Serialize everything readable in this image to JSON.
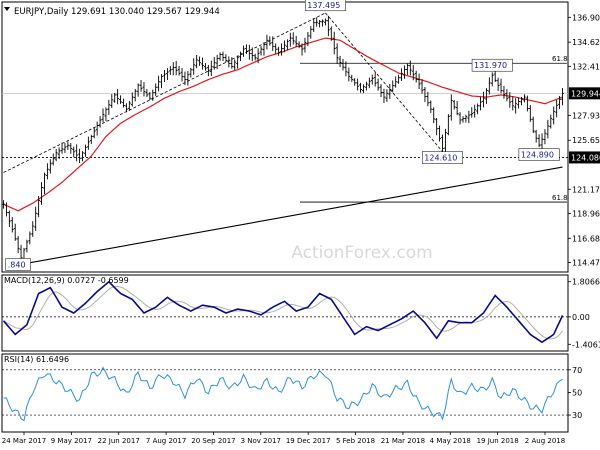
{
  "chart_data": {
    "type": "line",
    "header": {
      "symbol_label": "EURJPY,Daily",
      "ohlc": [
        "129.691",
        "130.040",
        "129.567",
        "129.944"
      ]
    },
    "watermark": "ActionForex.com",
    "x_ticks": [
      "24 Mar 2017",
      "9 May 2017",
      "22 Jun 2017",
      "7 Aug 2017",
      "20 Sep 2017",
      "3 Nov 2017",
      "19 Dec 2017",
      "5 Feb 2018",
      "21 Mar 2018",
      "4 May 2018",
      "19 Jun 2018",
      "2 Aug 2018"
    ],
    "price": {
      "ylim": [
        113.6,
        138.3
      ],
      "y_ticks": [
        "136.900",
        "134.625",
        "132.415",
        "127.930",
        "125.655",
        "121.170",
        "118.960",
        "116.685",
        "114.475"
      ],
      "y_tick_values": [
        136.9,
        134.625,
        132.415,
        127.93,
        125.655,
        121.17,
        118.96,
        116.685,
        114.475
      ],
      "current_price": {
        "label": "129.944",
        "value": 129.944
      },
      "support_level": {
        "label": "124.080",
        "value": 124.08
      },
      "fib_levels": [
        {
          "label": "61.8",
          "value": 132.7
        },
        {
          "label": "61.8",
          "value": 120.0
        }
      ],
      "callouts": [
        {
          "label": "137.495",
          "value": 137.495,
          "bar": 110,
          "position": "above"
        },
        {
          "label": "131.970",
          "value": 131.97,
          "bar": 167,
          "position": "above"
        },
        {
          "label": "124.610",
          "value": 124.61,
          "bar": 150,
          "position": "below"
        },
        {
          "label": "124.890",
          "value": 124.89,
          "bar": 183,
          "position": "below"
        },
        {
          "label": ".840",
          "value": 114.84,
          "bar": 5,
          "position": "below"
        }
      ],
      "close_anchors": [
        [
          0,
          119.8
        ],
        [
          3,
          117.5
        ],
        [
          6,
          114.9
        ],
        [
          10,
          117.8
        ],
        [
          14,
          122.5
        ],
        [
          18,
          124.5
        ],
        [
          22,
          125.2
        ],
        [
          26,
          124.0
        ],
        [
          30,
          126.0
        ],
        [
          34,
          128.0
        ],
        [
          38,
          129.8
        ],
        [
          42,
          128.5
        ],
        [
          46,
          130.7
        ],
        [
          50,
          129.5
        ],
        [
          54,
          131.5
        ],
        [
          58,
          132.3
        ],
        [
          62,
          131.2
        ],
        [
          66,
          133.0
        ],
        [
          70,
          132.0
        ],
        [
          74,
          133.5
        ],
        [
          78,
          132.4
        ],
        [
          82,
          134.0
        ],
        [
          86,
          133.2
        ],
        [
          90,
          134.8
        ],
        [
          94,
          133.7
        ],
        [
          98,
          135.0
        ],
        [
          102,
          134.0
        ],
        [
          106,
          136.4
        ],
        [
          110,
          136.6
        ],
        [
          114,
          133.2
        ],
        [
          118,
          131.5
        ],
        [
          122,
          130.3
        ],
        [
          126,
          131.3
        ],
        [
          130,
          129.6
        ],
        [
          134,
          131.0
        ],
        [
          138,
          132.5
        ],
        [
          142,
          130.8
        ],
        [
          146,
          128.5
        ],
        [
          150,
          124.9
        ],
        [
          153,
          129.3
        ],
        [
          156,
          127.5
        ],
        [
          160,
          128.1
        ],
        [
          164,
          129.5
        ],
        [
          167,
          131.6
        ],
        [
          170,
          130.2
        ],
        [
          174,
          128.8
        ],
        [
          178,
          129.6
        ],
        [
          181,
          126.5
        ],
        [
          183,
          125.2
        ],
        [
          185,
          126.3
        ],
        [
          188,
          128.3
        ],
        [
          191,
          129.944
        ]
      ],
      "moving_average_55": [
        [
          0,
          119.8
        ],
        [
          5,
          119.2
        ],
        [
          10,
          119.9
        ],
        [
          15,
          120.8
        ],
        [
          20,
          121.8
        ],
        [
          25,
          123.0
        ],
        [
          30,
          124.2
        ],
        [
          35,
          126.0
        ],
        [
          40,
          127.2
        ],
        [
          45,
          128.0
        ],
        [
          50,
          128.7
        ],
        [
          55,
          129.5
        ],
        [
          60,
          130.1
        ],
        [
          65,
          130.6
        ],
        [
          70,
          131.2
        ],
        [
          75,
          131.7
        ],
        [
          80,
          132.1
        ],
        [
          85,
          132.7
        ],
        [
          90,
          133.3
        ],
        [
          95,
          133.7
        ],
        [
          100,
          134.2
        ],
        [
          105,
          134.6
        ],
        [
          110,
          135.0
        ],
        [
          115,
          134.8
        ],
        [
          120,
          134.0
        ],
        [
          125,
          133.2
        ],
        [
          130,
          132.5
        ],
        [
          135,
          131.8
        ],
        [
          140,
          131.4
        ],
        [
          145,
          131.0
        ],
        [
          150,
          130.5
        ],
        [
          155,
          130.1
        ],
        [
          160,
          129.7
        ],
        [
          165,
          129.6
        ],
        [
          170,
          129.8
        ],
        [
          175,
          129.6
        ],
        [
          180,
          129.3
        ],
        [
          185,
          129.0
        ],
        [
          191,
          129.6
        ]
      ],
      "trendlines": [
        {
          "from": [
            0,
            122.7
          ],
          "to": [
            110,
            137.3
          ]
        },
        {
          "from": [
            110,
            137.3
          ],
          "to": [
            150,
            124.61
          ]
        },
        {
          "from": [
            6,
            114.3
          ],
          "to": [
            191,
            123.2
          ]
        }
      ]
    },
    "macd": {
      "label": "MACD(12,26,9) 0.0727 -0.6599",
      "ylim": [
        -1.75,
        2.15
      ],
      "y_ticks": [
        "1.8066",
        "0.00",
        "-1.4061"
      ],
      "y_tick_values": [
        1.8066,
        0.0,
        -1.4061
      ],
      "main_anchors": [
        [
          0,
          -0.2
        ],
        [
          4,
          -0.9
        ],
        [
          8,
          -0.4
        ],
        [
          12,
          1.2
        ],
        [
          16,
          1.5
        ],
        [
          20,
          0.5
        ],
        [
          24,
          0.2
        ],
        [
          28,
          0.7
        ],
        [
          32,
          1.3
        ],
        [
          36,
          1.8
        ],
        [
          40,
          1.2
        ],
        [
          44,
          0.9
        ],
        [
          48,
          0.2
        ],
        [
          52,
          0.5
        ],
        [
          56,
          1.0
        ],
        [
          60,
          0.6
        ],
        [
          64,
          0.3
        ],
        [
          68,
          0.6
        ],
        [
          72,
          0.5
        ],
        [
          76,
          0.2
        ],
        [
          80,
          0.4
        ],
        [
          84,
          0.3
        ],
        [
          88,
          0.1
        ],
        [
          92,
          0.5
        ],
        [
          96,
          0.8
        ],
        [
          100,
          0.3
        ],
        [
          104,
          0.5
        ],
        [
          108,
          1.2
        ],
        [
          112,
          0.9
        ],
        [
          116,
          0.0
        ],
        [
          120,
          -0.9
        ],
        [
          124,
          -0.5
        ],
        [
          128,
          -0.7
        ],
        [
          132,
          -0.4
        ],
        [
          136,
          -0.1
        ],
        [
          140,
          0.3
        ],
        [
          144,
          -0.3
        ],
        [
          148,
          -1.1
        ],
        [
          152,
          -0.2
        ],
        [
          156,
          -0.3
        ],
        [
          160,
          -0.3
        ],
        [
          164,
          0.2
        ],
        [
          168,
          1.1
        ],
        [
          172,
          0.5
        ],
        [
          176,
          -0.2
        ],
        [
          180,
          -0.9
        ],
        [
          184,
          -1.3
        ],
        [
          188,
          -0.9
        ],
        [
          191,
          0.0727
        ]
      ],
      "signal_lag": 3
    },
    "rsi": {
      "label": "RSI(14) 61.6496",
      "ylim": [
        15,
        84
      ],
      "y_ticks": [
        "70",
        "50",
        "30"
      ],
      "y_tick_values": [
        70,
        50,
        30
      ],
      "anchors": [
        [
          0,
          45
        ],
        [
          4,
          33
        ],
        [
          7,
          27
        ],
        [
          10,
          52
        ],
        [
          14,
          67
        ],
        [
          18,
          60
        ],
        [
          22,
          52
        ],
        [
          26,
          43
        ],
        [
          30,
          65
        ],
        [
          34,
          69
        ],
        [
          38,
          61
        ],
        [
          42,
          48
        ],
        [
          46,
          67
        ],
        [
          50,
          54
        ],
        [
          54,
          66
        ],
        [
          58,
          60
        ],
        [
          62,
          48
        ],
        [
          66,
          63
        ],
        [
          70,
          50
        ],
        [
          74,
          62
        ],
        [
          78,
          54
        ],
        [
          82,
          63
        ],
        [
          86,
          52
        ],
        [
          90,
          60
        ],
        [
          94,
          50
        ],
        [
          98,
          63
        ],
        [
          102,
          55
        ],
        [
          106,
          65
        ],
        [
          110,
          67
        ],
        [
          114,
          45
        ],
        [
          118,
          37
        ],
        [
          122,
          43
        ],
        [
          126,
          56
        ],
        [
          130,
          45
        ],
        [
          134,
          53
        ],
        [
          138,
          58
        ],
        [
          142,
          40
        ],
        [
          146,
          33
        ],
        [
          150,
          28
        ],
        [
          153,
          60
        ],
        [
          156,
          48
        ],
        [
          160,
          55
        ],
        [
          164,
          52
        ],
        [
          167,
          60
        ],
        [
          170,
          45
        ],
        [
          174,
          52
        ],
        [
          178,
          43
        ],
        [
          181,
          36
        ],
        [
          184,
          35
        ],
        [
          188,
          52
        ],
        [
          191,
          61.6496
        ]
      ]
    }
  }
}
